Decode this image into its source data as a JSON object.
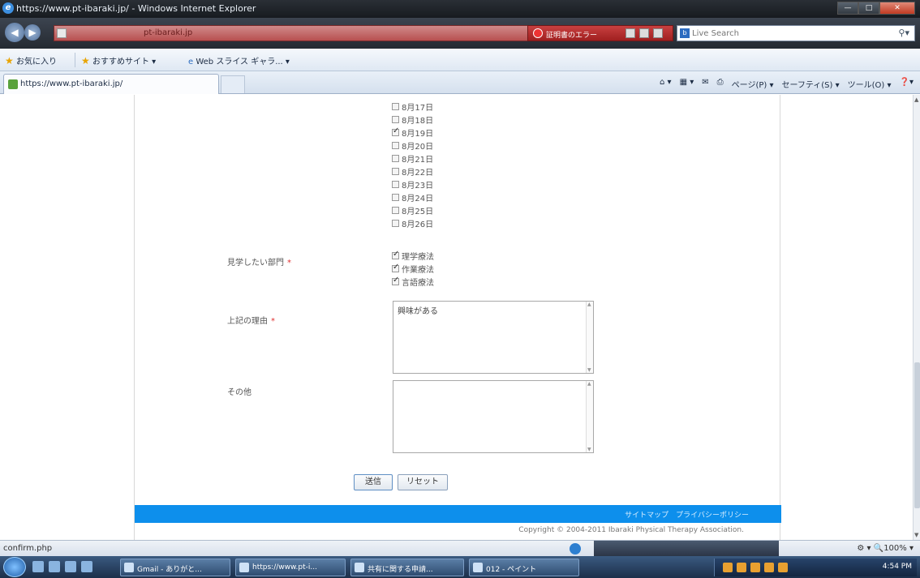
{
  "window": {
    "title": "https://www.pt-ibaraki.jp/ - Windows Internet Explorer",
    "min": "—",
    "max": "□",
    "close": "✕"
  },
  "address": {
    "url": "pt-ibaraki.jp",
    "cert_label": "証明書のエラー",
    "search_placeholder": "Live Search"
  },
  "favorites": {
    "favorites_label": "お気に入り",
    "suggested_sites": "おすすめサイト ▾",
    "web_slice": "Web スライス ギャラ... ▾"
  },
  "tabs": {
    "active": "https://www.pt-ibaraki.jp/",
    "commands": [
      "▾",
      "▾",
      "ページ(P) ▾",
      "セーフティ(S) ▾",
      "ツール(O) ▾",
      "❓▾"
    ]
  },
  "form": {
    "dates": [
      {
        "label": "8月17日",
        "checked": false
      },
      {
        "label": "8月18日",
        "checked": false
      },
      {
        "label": "8月19日",
        "checked": true
      },
      {
        "label": "8月20日",
        "checked": false
      },
      {
        "label": "8月21日",
        "checked": false
      },
      {
        "label": "8月22日",
        "checked": false
      },
      {
        "label": "8月23日",
        "checked": false
      },
      {
        "label": "8月24日",
        "checked": false
      },
      {
        "label": "8月25日",
        "checked": false
      },
      {
        "label": "8月26日",
        "checked": false
      }
    ],
    "dept_label": "見学したい部門",
    "required_mark": "*",
    "departments": [
      {
        "label": "理学療法",
        "checked": true
      },
      {
        "label": "作業療法",
        "checked": true
      },
      {
        "label": "言語療法",
        "checked": true
      }
    ],
    "reason_label": "上記の理由",
    "reason_value": "興味がある",
    "other_label": "その他",
    "other_value": "",
    "submit_label": "送信",
    "reset_label": "リセット"
  },
  "footer": {
    "links": "サイトマップ　プライバシーポリシー",
    "copyright": "Copyright © 2004-2011 Ibaraki Physical Therapy Association."
  },
  "statusbar": {
    "text": "confirm.php",
    "zoom": "⚙ ▾   🔍100% ▾"
  },
  "taskbar": {
    "buttons": [
      "Gmail - ありがと...",
      "https://www.pt-i...",
      "共有に関する申請...",
      "012 - ペイント"
    ],
    "clock": "4:54 PM"
  }
}
